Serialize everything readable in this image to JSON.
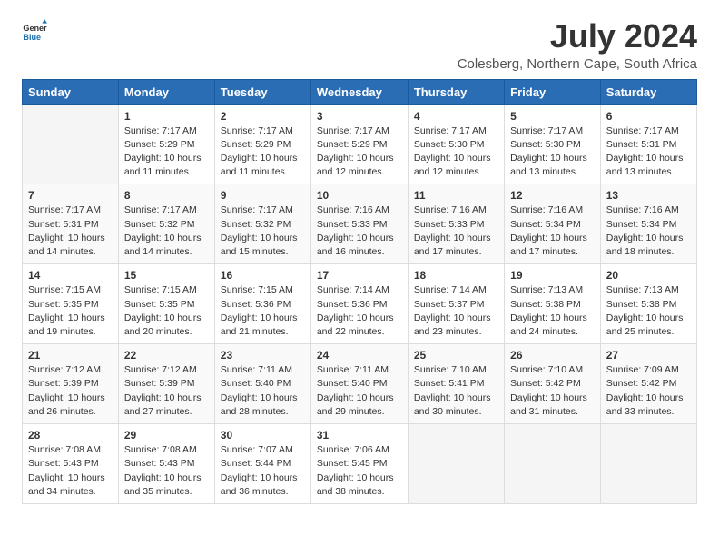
{
  "logo": {
    "general": "General",
    "blue": "Blue"
  },
  "title": "July 2024",
  "subtitle": "Colesberg, Northern Cape, South Africa",
  "days_of_week": [
    "Sunday",
    "Monday",
    "Tuesday",
    "Wednesday",
    "Thursday",
    "Friday",
    "Saturday"
  ],
  "weeks": [
    [
      {
        "day": "",
        "info": ""
      },
      {
        "day": "1",
        "info": "Sunrise: 7:17 AM\nSunset: 5:29 PM\nDaylight: 10 hours\nand 11 minutes."
      },
      {
        "day": "2",
        "info": "Sunrise: 7:17 AM\nSunset: 5:29 PM\nDaylight: 10 hours\nand 11 minutes."
      },
      {
        "day": "3",
        "info": "Sunrise: 7:17 AM\nSunset: 5:29 PM\nDaylight: 10 hours\nand 12 minutes."
      },
      {
        "day": "4",
        "info": "Sunrise: 7:17 AM\nSunset: 5:30 PM\nDaylight: 10 hours\nand 12 minutes."
      },
      {
        "day": "5",
        "info": "Sunrise: 7:17 AM\nSunset: 5:30 PM\nDaylight: 10 hours\nand 13 minutes."
      },
      {
        "day": "6",
        "info": "Sunrise: 7:17 AM\nSunset: 5:31 PM\nDaylight: 10 hours\nand 13 minutes."
      }
    ],
    [
      {
        "day": "7",
        "info": "Sunrise: 7:17 AM\nSunset: 5:31 PM\nDaylight: 10 hours\nand 14 minutes."
      },
      {
        "day": "8",
        "info": "Sunrise: 7:17 AM\nSunset: 5:32 PM\nDaylight: 10 hours\nand 14 minutes."
      },
      {
        "day": "9",
        "info": "Sunrise: 7:17 AM\nSunset: 5:32 PM\nDaylight: 10 hours\nand 15 minutes."
      },
      {
        "day": "10",
        "info": "Sunrise: 7:16 AM\nSunset: 5:33 PM\nDaylight: 10 hours\nand 16 minutes."
      },
      {
        "day": "11",
        "info": "Sunrise: 7:16 AM\nSunset: 5:33 PM\nDaylight: 10 hours\nand 17 minutes."
      },
      {
        "day": "12",
        "info": "Sunrise: 7:16 AM\nSunset: 5:34 PM\nDaylight: 10 hours\nand 17 minutes."
      },
      {
        "day": "13",
        "info": "Sunrise: 7:16 AM\nSunset: 5:34 PM\nDaylight: 10 hours\nand 18 minutes."
      }
    ],
    [
      {
        "day": "14",
        "info": "Sunrise: 7:15 AM\nSunset: 5:35 PM\nDaylight: 10 hours\nand 19 minutes."
      },
      {
        "day": "15",
        "info": "Sunrise: 7:15 AM\nSunset: 5:35 PM\nDaylight: 10 hours\nand 20 minutes."
      },
      {
        "day": "16",
        "info": "Sunrise: 7:15 AM\nSunset: 5:36 PM\nDaylight: 10 hours\nand 21 minutes."
      },
      {
        "day": "17",
        "info": "Sunrise: 7:14 AM\nSunset: 5:36 PM\nDaylight: 10 hours\nand 22 minutes."
      },
      {
        "day": "18",
        "info": "Sunrise: 7:14 AM\nSunset: 5:37 PM\nDaylight: 10 hours\nand 23 minutes."
      },
      {
        "day": "19",
        "info": "Sunrise: 7:13 AM\nSunset: 5:38 PM\nDaylight: 10 hours\nand 24 minutes."
      },
      {
        "day": "20",
        "info": "Sunrise: 7:13 AM\nSunset: 5:38 PM\nDaylight: 10 hours\nand 25 minutes."
      }
    ],
    [
      {
        "day": "21",
        "info": "Sunrise: 7:12 AM\nSunset: 5:39 PM\nDaylight: 10 hours\nand 26 minutes."
      },
      {
        "day": "22",
        "info": "Sunrise: 7:12 AM\nSunset: 5:39 PM\nDaylight: 10 hours\nand 27 minutes."
      },
      {
        "day": "23",
        "info": "Sunrise: 7:11 AM\nSunset: 5:40 PM\nDaylight: 10 hours\nand 28 minutes."
      },
      {
        "day": "24",
        "info": "Sunrise: 7:11 AM\nSunset: 5:40 PM\nDaylight: 10 hours\nand 29 minutes."
      },
      {
        "day": "25",
        "info": "Sunrise: 7:10 AM\nSunset: 5:41 PM\nDaylight: 10 hours\nand 30 minutes."
      },
      {
        "day": "26",
        "info": "Sunrise: 7:10 AM\nSunset: 5:42 PM\nDaylight: 10 hours\nand 31 minutes."
      },
      {
        "day": "27",
        "info": "Sunrise: 7:09 AM\nSunset: 5:42 PM\nDaylight: 10 hours\nand 33 minutes."
      }
    ],
    [
      {
        "day": "28",
        "info": "Sunrise: 7:08 AM\nSunset: 5:43 PM\nDaylight: 10 hours\nand 34 minutes."
      },
      {
        "day": "29",
        "info": "Sunrise: 7:08 AM\nSunset: 5:43 PM\nDaylight: 10 hours\nand 35 minutes."
      },
      {
        "day": "30",
        "info": "Sunrise: 7:07 AM\nSunset: 5:44 PM\nDaylight: 10 hours\nand 36 minutes."
      },
      {
        "day": "31",
        "info": "Sunrise: 7:06 AM\nSunset: 5:45 PM\nDaylight: 10 hours\nand 38 minutes."
      },
      {
        "day": "",
        "info": ""
      },
      {
        "day": "",
        "info": ""
      },
      {
        "day": "",
        "info": ""
      }
    ]
  ]
}
